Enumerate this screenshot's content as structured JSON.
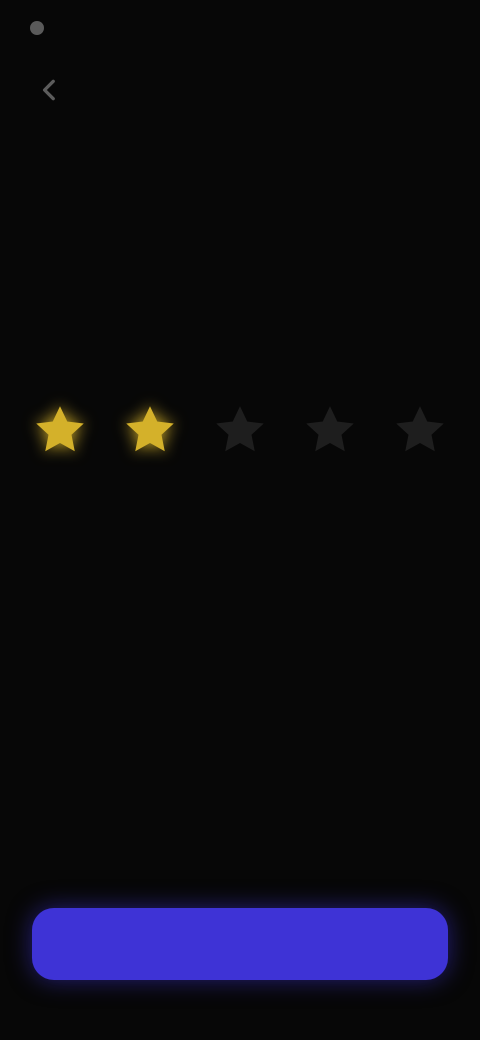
{
  "status_bar": {
    "time": ""
  },
  "header": {
    "back_icon": "chevron-left-icon"
  },
  "title": "",
  "subtitle": "",
  "rating": {
    "value": 2,
    "max": 5,
    "active_color": "#d4b12a",
    "inactive_color": "#1e1e1e",
    "icon": "star-icon",
    "label": ""
  },
  "submit_button": {
    "label": "",
    "color": "#3e33d6"
  }
}
